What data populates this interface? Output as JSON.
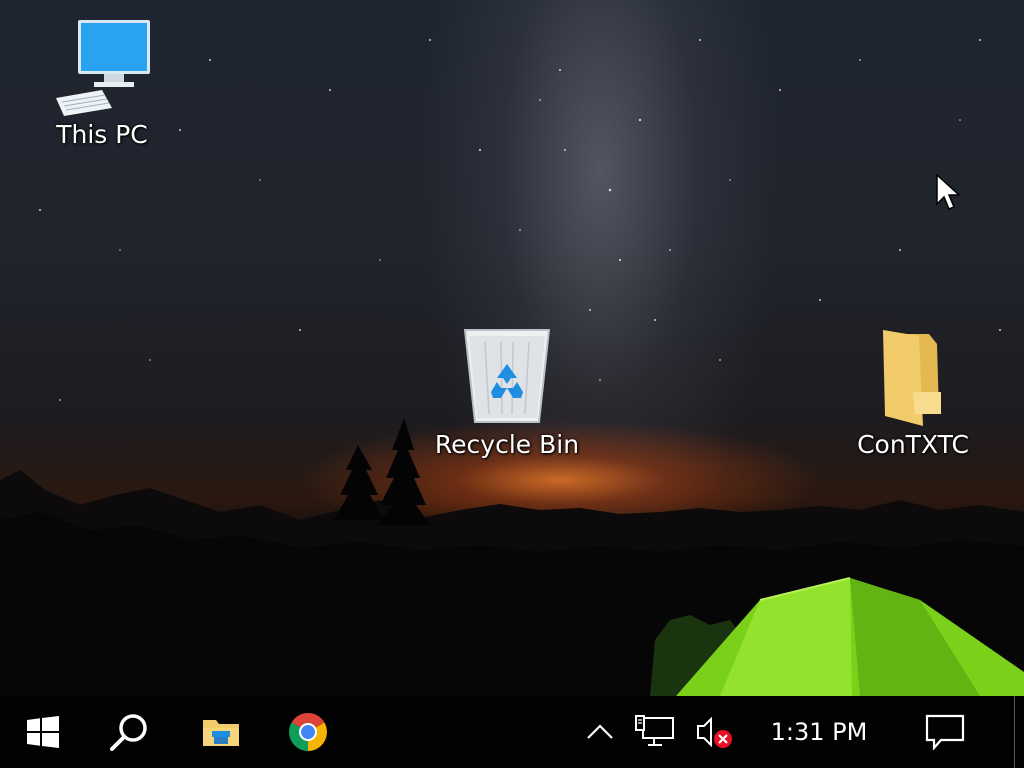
{
  "desktop": {
    "icons": [
      {
        "label": "This PC",
        "icon": "this-pc-icon"
      },
      {
        "label": "Recycle Bin",
        "icon": "recycle-bin-icon"
      },
      {
        "label": "ConTXTC",
        "icon": "folder-icon"
      }
    ]
  },
  "taskbar": {
    "start_icon": "windows-logo-icon",
    "search_icon": "search-icon",
    "pinned": [
      {
        "name": "File Explorer",
        "icon": "file-explorer-icon"
      },
      {
        "name": "Google Chrome",
        "icon": "chrome-icon"
      }
    ],
    "tray": {
      "overflow_icon": "chevron-up-icon",
      "network_icon": "network-icon",
      "volume_icon": "volume-muted-icon",
      "time": "1:31 PM",
      "notifications_icon": "action-center-icon"
    }
  },
  "colors": {
    "taskbar": "#020202",
    "accent_blue": "#1e8fe0",
    "folder_yellow": "#f2cb6a",
    "chrome_red": "#db4437",
    "chrome_green": "#0f9d58",
    "chrome_yellow": "#f4b400",
    "chrome_blue": "#4285f4",
    "tent_green": "#7bd11a",
    "mute_red": "#e81123"
  }
}
